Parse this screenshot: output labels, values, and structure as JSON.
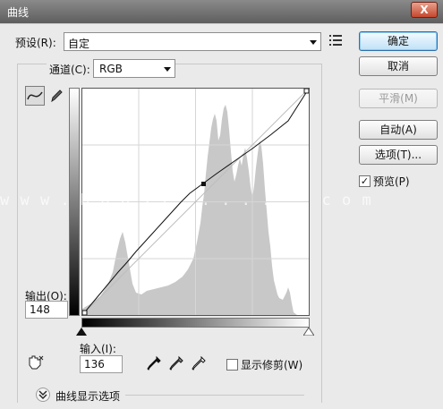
{
  "window": {
    "title": "曲线",
    "close_glyph": "X"
  },
  "preset": {
    "label": "预设(R):",
    "value": "自定"
  },
  "channel": {
    "label": "通道(C):",
    "value": "RGB"
  },
  "output": {
    "label": "输出(O):",
    "value": "148"
  },
  "input": {
    "label": "输入(I):",
    "value": "136"
  },
  "show_clipping": {
    "label": "显示修剪(W)",
    "checked": false
  },
  "curve_display_options": {
    "label": "曲线显示选项"
  },
  "buttons": {
    "ok": "确定",
    "cancel": "取消",
    "smooth": "平滑(M)",
    "auto": "自动(A)",
    "options": "选项(T)..."
  },
  "preview": {
    "label": "预览(P)",
    "checked": true,
    "check_glyph": "✓"
  },
  "watermark": "w w w . b o o s t . . . . . . . c o m",
  "curve": {
    "input": 136,
    "output": 148
  },
  "icons": [
    "menu-icon",
    "curve-tool-icon",
    "pencil-icon",
    "hand-adjust-icon",
    "black-eyedropper-icon",
    "gray-eyedropper-icon",
    "white-eyedropper-icon",
    "chevron-down-icon"
  ]
}
